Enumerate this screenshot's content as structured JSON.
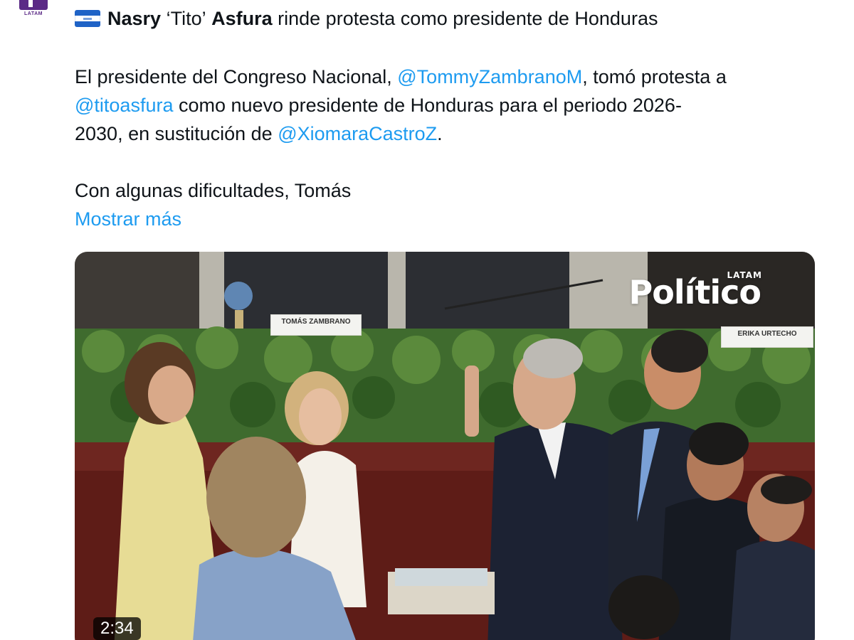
{
  "source": {
    "avatar_label": "LATAM"
  },
  "headline": {
    "name_part1": "Nasry",
    "name_part2": "‘Tito’",
    "name_part3": "Asfura",
    "rest": " rinde protesta como presidente de Honduras"
  },
  "body": {
    "line1_a": "El presidente del Congreso Nacional, ",
    "line1_mention": "@TommyZambranoM",
    "line1_b": ", tomó protesta a",
    "line2_mention": "@titoasfura",
    "line2_b": " como nuevo presidente de Honduras para el periodo 2026-",
    "line3_a": "2030, en sustitución de ",
    "line3_mention": "@XiomaraCastroZ",
    "line3_b": ".",
    "line4": "Con algunas dificultades, Tomás",
    "show_more": "Mostrar más"
  },
  "media": {
    "watermark": "Político",
    "watermark_sub": "LATAM",
    "nameplate_1": "TOMÁS ZAMBRANO",
    "nameplate_2": "ERIKA URTECHO",
    "duration": "2:34"
  },
  "colors": {
    "link": "#1d9bf0",
    "text": "#0f1419",
    "brand": "#5b2a86"
  }
}
